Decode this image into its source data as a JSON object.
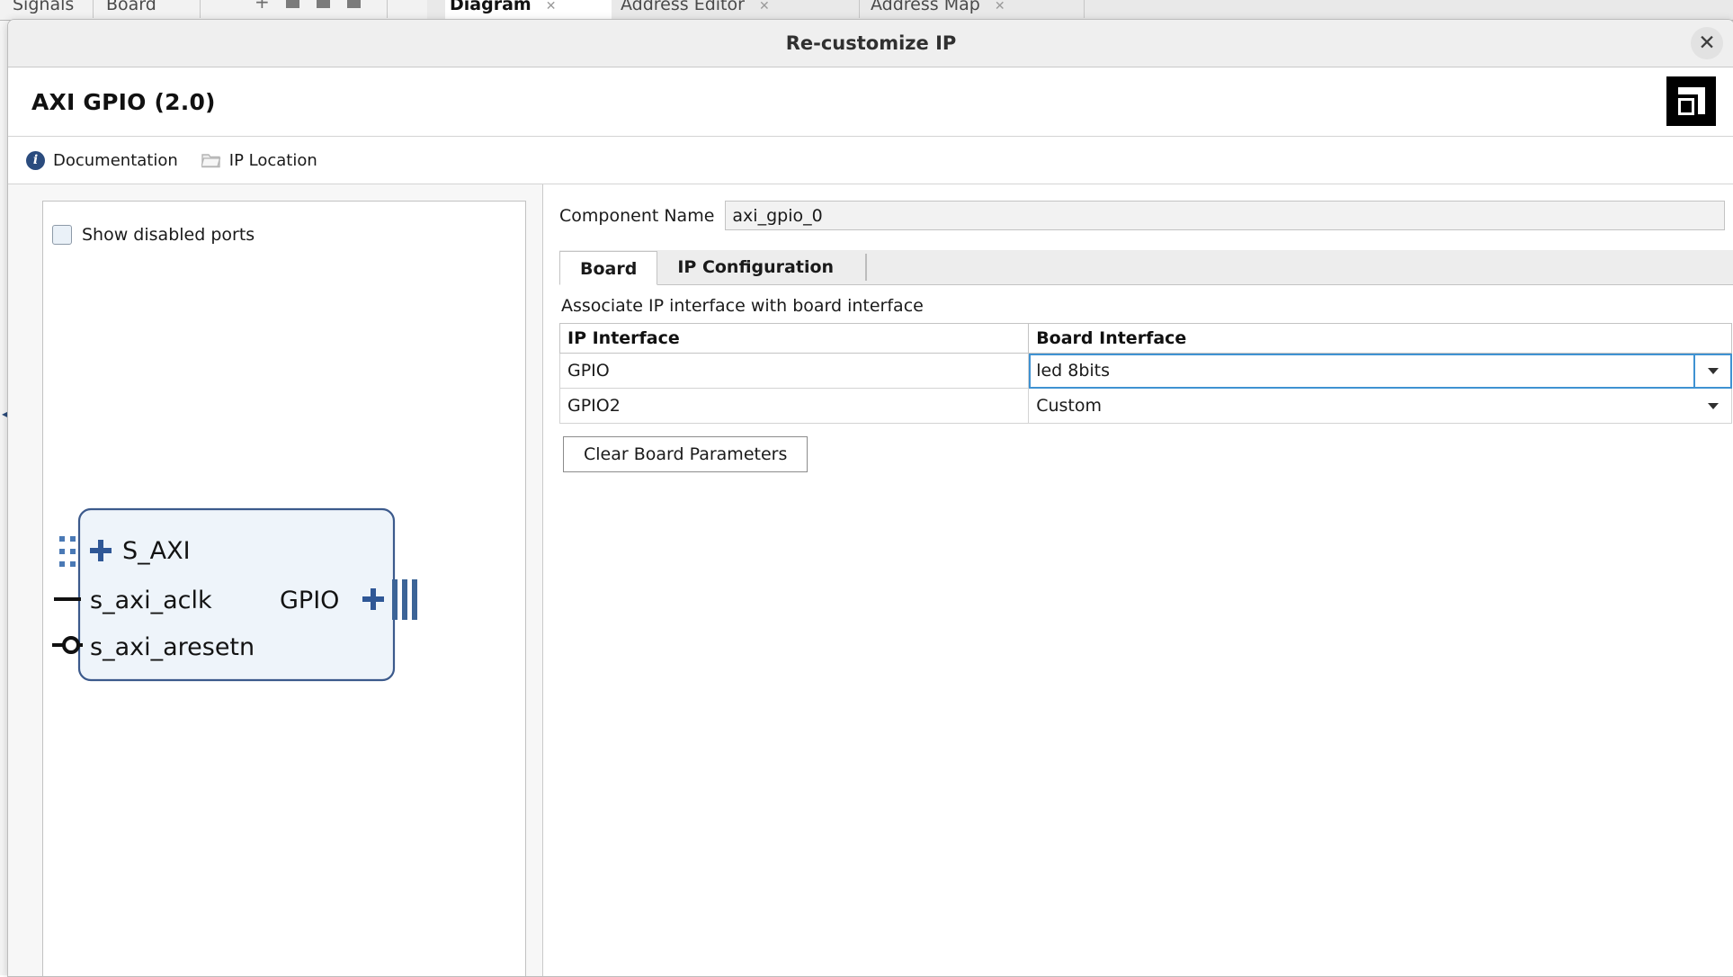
{
  "background": {
    "tabs": [
      {
        "label": "Signals",
        "active": false,
        "closable": false
      },
      {
        "label": "Board",
        "active": false,
        "closable": false
      }
    ],
    "panel_tabs": [
      {
        "label": "Diagram",
        "active": true,
        "close_icon": "close-x-icon"
      },
      {
        "label": "Address Editor",
        "active": false,
        "close_icon": "close-x-icon"
      },
      {
        "label": "Address Map",
        "active": false,
        "close_icon": "close-x-icon"
      }
    ],
    "rail_icon": "collapse-chevron-left-icon"
  },
  "dialog": {
    "title": "Re-customize IP",
    "close_icon": "close-x-icon",
    "ip_title": "AXI GPIO (2.0)",
    "vendor_logo": "amd-logo-icon",
    "toolbar": {
      "documentation": {
        "label": "Documentation",
        "icon": "info-circle-icon"
      },
      "ip_location": {
        "label": "IP Location",
        "icon": "folder-icon"
      }
    }
  },
  "left_pane": {
    "show_disabled_ports": {
      "label": "Show disabled ports",
      "checked": false
    },
    "symbol": {
      "left_ports": [
        {
          "name": "S_AXI",
          "type": "bus",
          "expand_icon": "plus-icon"
        },
        {
          "name": "s_axi_aclk",
          "type": "clock"
        },
        {
          "name": "s_axi_aresetn",
          "type": "reset-active-low"
        }
      ],
      "right_ports": [
        {
          "name": "GPIO",
          "type": "bus",
          "expand_icon": "plus-icon"
        }
      ]
    }
  },
  "right_pane": {
    "component_name": {
      "label": "Component Name",
      "value": "axi_gpio_0",
      "placeholder": "axi_gpio_0"
    },
    "tabs": [
      {
        "label": "Board",
        "active": true
      },
      {
        "label": "IP Configuration",
        "active": false
      }
    ],
    "board_tab": {
      "description": "Associate IP interface with board interface",
      "table": {
        "columns": [
          "IP Interface",
          "Board Interface"
        ],
        "rows": [
          {
            "ip_interface": "GPIO",
            "board_interface": "led 8bits",
            "selected": true
          },
          {
            "ip_interface": "GPIO2",
            "board_interface": "Custom",
            "selected": false
          }
        ]
      },
      "clear_button": "Clear Board Parameters"
    }
  },
  "colors": {
    "accent_blue": "#3f92d2",
    "symbol_border": "#3c5a8c",
    "symbol_fill": "#eef4fa",
    "info_blue": "#2b4c7e",
    "dialog_chrome": "#efefef"
  }
}
